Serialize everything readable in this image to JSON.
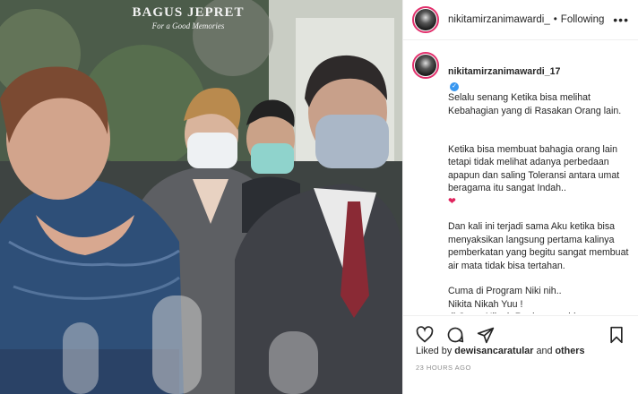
{
  "photo": {
    "watermark_title": "BAGUS JEPRET",
    "watermark_subtitle": "For a Good Memories"
  },
  "header": {
    "username": "nikitamirzanimawardi_",
    "separator": "•",
    "follow_label": "Following",
    "more_icon": "more-horizontal-icon"
  },
  "caption": {
    "username": "nikitamirzanimawardi_17",
    "verified_icon": "verified-badge-icon",
    "paragraphs": [
      "Selalu senang Ketika bisa melihat Kebahagian yang di Rasakan Orang lain.",
      "Ketika bisa membuat bahagia orang lain tetapi tidak melihat adanya perbedaan apapun dan saling Toleransi antara umat beragama itu sangat Indah..",
      "Dan kali ini terjadi sama Aku ketika bisa menyaksikan langsung pertama kalinya pemberkatan yang begitu sangat membuat air mata tidak bisa tertahan.",
      "Cuma di Program Niki nih..\nNikita Nikah Yuu !\ndi Crazy Nikmir Real semua bisa\nterjadi dan terlaksana.."
    ],
    "heart_glyph": "❤"
  },
  "actions": {
    "like_icon": "heart-outline-icon",
    "comment_icon": "comment-icon",
    "share_icon": "send-icon",
    "save_icon": "bookmark-icon"
  },
  "likes": {
    "prefix": "Liked by",
    "user": "dewisancaratular",
    "conjunction": "and",
    "others": "others"
  },
  "timestamp": "23 HOURS AGO",
  "colors": {
    "accent": "#3897f0",
    "heart": "#e0245e",
    "story_ring": "#e1306c",
    "muted_text": "#8e8e8e"
  }
}
